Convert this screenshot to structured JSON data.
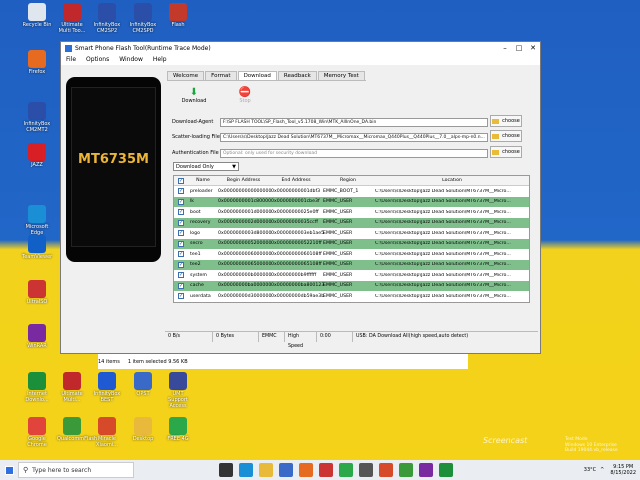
{
  "desktop": {
    "icons": [
      {
        "label": "Recycle Bin",
        "color": "#dfe6ee"
      },
      {
        "label": "Ultimate Multi Too...",
        "color": "#c0282c"
      },
      {
        "label": "InfinityBox CM2SP2",
        "color": "#2b4fa8"
      },
      {
        "label": "InfinityBox CM2SPD",
        "color": "#2b4fa8"
      },
      {
        "label": "Flash",
        "color": "#c43a2a"
      },
      {
        "label": "Firefox",
        "color": "#e66a1f"
      },
      {
        "label": "InfinityBox CM2MT2",
        "color": "#2b4fa8"
      },
      {
        "label": "JAZZ",
        "color": "#d81f26"
      },
      {
        "label": "Microsoft Edge",
        "color": "#1a8fd6"
      },
      {
        "label": "TeamViewer",
        "color": "#1060c8"
      },
      {
        "label": "UltraISO",
        "color": "#cc3333"
      },
      {
        "label": "WinRAR",
        "color": "#7a2aa0"
      },
      {
        "label": "Internet Downlo...",
        "color": "#1c8f3a"
      },
      {
        "label": "Ultimate Multi...",
        "color": "#c0282c"
      },
      {
        "label": "InfinityBox BEST",
        "color": "#1f5ad2"
      },
      {
        "label": "QPST",
        "color": "#3a6ac8"
      },
      {
        "label": "UMT Support Access",
        "color": "#3a4a9a"
      },
      {
        "label": "Google Chrome",
        "color": "#e0443a"
      },
      {
        "label": "QualcommFlash",
        "color": "#3a9a3a"
      },
      {
        "label": "Miracle Xiaomi...",
        "color": "#d64a2a"
      },
      {
        "label": "Desktop",
        "color": "#e8b93a"
      },
      {
        "label": "FREE 4G",
        "color": "#2aa84a"
      }
    ]
  },
  "app": {
    "title": "Smart Phone Flash Tool(Runtime Trace Mode)",
    "menu": [
      "File",
      "Options",
      "Window",
      "Help"
    ],
    "phone_model": "MT6735M",
    "tabs": [
      "Welcome",
      "Format",
      "Download",
      "Readback",
      "Memory Test"
    ],
    "active_tab": "Download",
    "toolbar": {
      "download_label": "Download",
      "stop_label": "Stop"
    },
    "form": {
      "download_agent_label": "Download-Agent",
      "download_agent_value": "F:\\SP FLASH TOOL\\SP_Flash_Tool_v5.1708_Win\\MTK_AllInOne_DA.bin",
      "scatter_label": "Scatter-loading File",
      "scatter_value": "C:\\Users\\s\\Desktop\\Jazz Dead Solution\\MT6737M__Micromax__Micromax_Q440Plus__Q440Plus__7.0__alps-mp-n0.n...",
      "auth_label": "Authentication File",
      "auth_placeholder": "Optional: only used for security download",
      "choose_label": "choose"
    },
    "mode": "Download Only",
    "table": {
      "headers": [
        "Name",
        "Begin Address",
        "End Address",
        "Region",
        "Location"
      ],
      "rows": [
        {
          "name": "preloader",
          "begin": "0x0000000000000000",
          "end": "0x00000000001dbf3",
          "region": "EMMC_BOOT_1",
          "location": "C:\\Users\\s\\Desktop\\Jazz Dead Solution\\MT6737M__Micro...",
          "shade": "white"
        },
        {
          "name": "lk",
          "begin": "0x0000000001c80000",
          "end": "0x0000000001cbe3f",
          "region": "EMMC_USER",
          "location": "C:\\Users\\s\\Desktop\\Jazz Dead Solution\\MT6737M__Micro...",
          "shade": "green"
        },
        {
          "name": "boot",
          "begin": "0x0000000001d00000",
          "end": "0x00000000025e0ff",
          "region": "EMMC_USER",
          "location": "C:\\Users\\s\\Desktop\\Jazz Dead Solution\\MT6737M__Micro...",
          "shade": "white"
        },
        {
          "name": "recovery",
          "begin": "0x0000000002d00000",
          "end": "0x00000000035ccff",
          "region": "EMMC_USER",
          "location": "C:\\Users\\s\\Desktop\\Jazz Dead Solution\\MT6737M__Micro...",
          "shade": "green"
        },
        {
          "name": "logo",
          "begin": "0x0000000003d80000",
          "end": "0x0000000003eb1ae5",
          "region": "EMMC_USER",
          "location": "C:\\Users\\s\\Desktop\\Jazz Dead Solution\\MT6737M__Micro...",
          "shade": "white"
        },
        {
          "name": "secro",
          "begin": "0x0000000005200000",
          "end": "0x00000000052210ff",
          "region": "EMMC_USER",
          "location": "C:\\Users\\s\\Desktop\\Jazz Dead Solution\\MT6737M__Micro...",
          "shade": "green"
        },
        {
          "name": "tee1",
          "begin": "0x0000000006000000",
          "end": "0x00000000060108ff",
          "region": "EMMC_USER",
          "location": "C:\\Users\\s\\Desktop\\Jazz Dead Solution\\MT6737M__Micro...",
          "shade": "white"
        },
        {
          "name": "tee2",
          "begin": "0x0000000006500000",
          "end": "0x00000000065108ff",
          "region": "EMMC_USER",
          "location": "C:\\Users\\s\\Desktop\\Jazz Dead Solution\\MT6737M__Micro...",
          "shade": "green"
        },
        {
          "name": "system",
          "begin": "0x000000000b000000",
          "end": "0x00000000b9ffffff",
          "region": "EMMC_USER",
          "location": "C:\\Users\\s\\Desktop\\Jazz Dead Solution\\MT6737M__Micro...",
          "shade": "white"
        },
        {
          "name": "cache",
          "begin": "0x00000000ba000000",
          "end": "0x00000000ba800123",
          "region": "EMMC_USER",
          "location": "C:\\Users\\s\\Desktop\\Jazz Dead Solution\\MT6737M__Micro...",
          "shade": "green"
        },
        {
          "name": "userdata",
          "begin": "0x00000000d3000000",
          "end": "0x00000000db59ae3b",
          "region": "EMMC_USER",
          "location": "C:\\Users\\s\\Desktop\\Jazz Dead Solution\\MT6737M__Micro...",
          "shade": "white"
        }
      ]
    },
    "status": {
      "progress": "0 B/s",
      "bytes": "0 Bytes",
      "storage": "EMMC",
      "speed": "High Speed",
      "time": "0:00",
      "info": "USB: DA Download All(high speed,auto detect)"
    }
  },
  "explorer": {
    "items": "14 items",
    "selected": "1 item selected  9.56 KB"
  },
  "taskbar": {
    "search_placeholder": "Type here to search",
    "temp": "33°C",
    "time": "9:15 PM",
    "date": "8/15/2022",
    "watermark": "Screencast",
    "activate_text": "Test Mode\nWindows 10 Enterprise\nBuild 19044.vb_release"
  },
  "colors": {
    "green_row": "#7fbf8c",
    "accent": "#2b6fd6",
    "model_text": "#ecb53a"
  }
}
